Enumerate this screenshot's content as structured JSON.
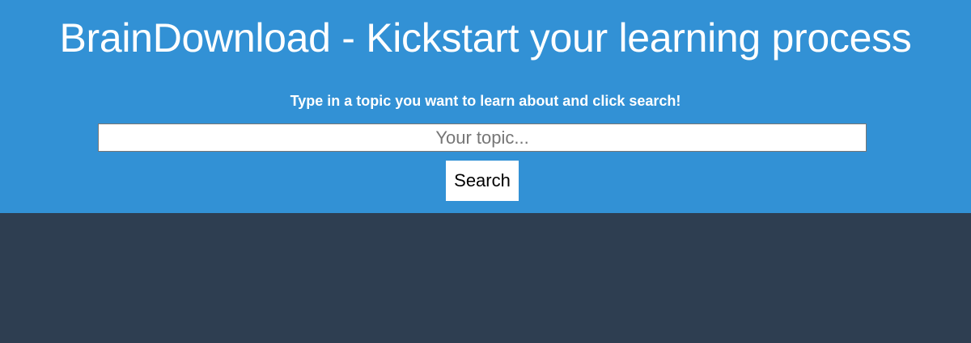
{
  "header": {
    "title": "BrainDownload - Kickstart your learning process",
    "subtitle": "Type in a topic you want to learn about and click search!",
    "background_color": "#3291d5"
  },
  "search": {
    "placeholder": "Your topic...",
    "value": "",
    "button_label": "Search"
  },
  "content": {
    "background_color": "#2e3e51"
  }
}
